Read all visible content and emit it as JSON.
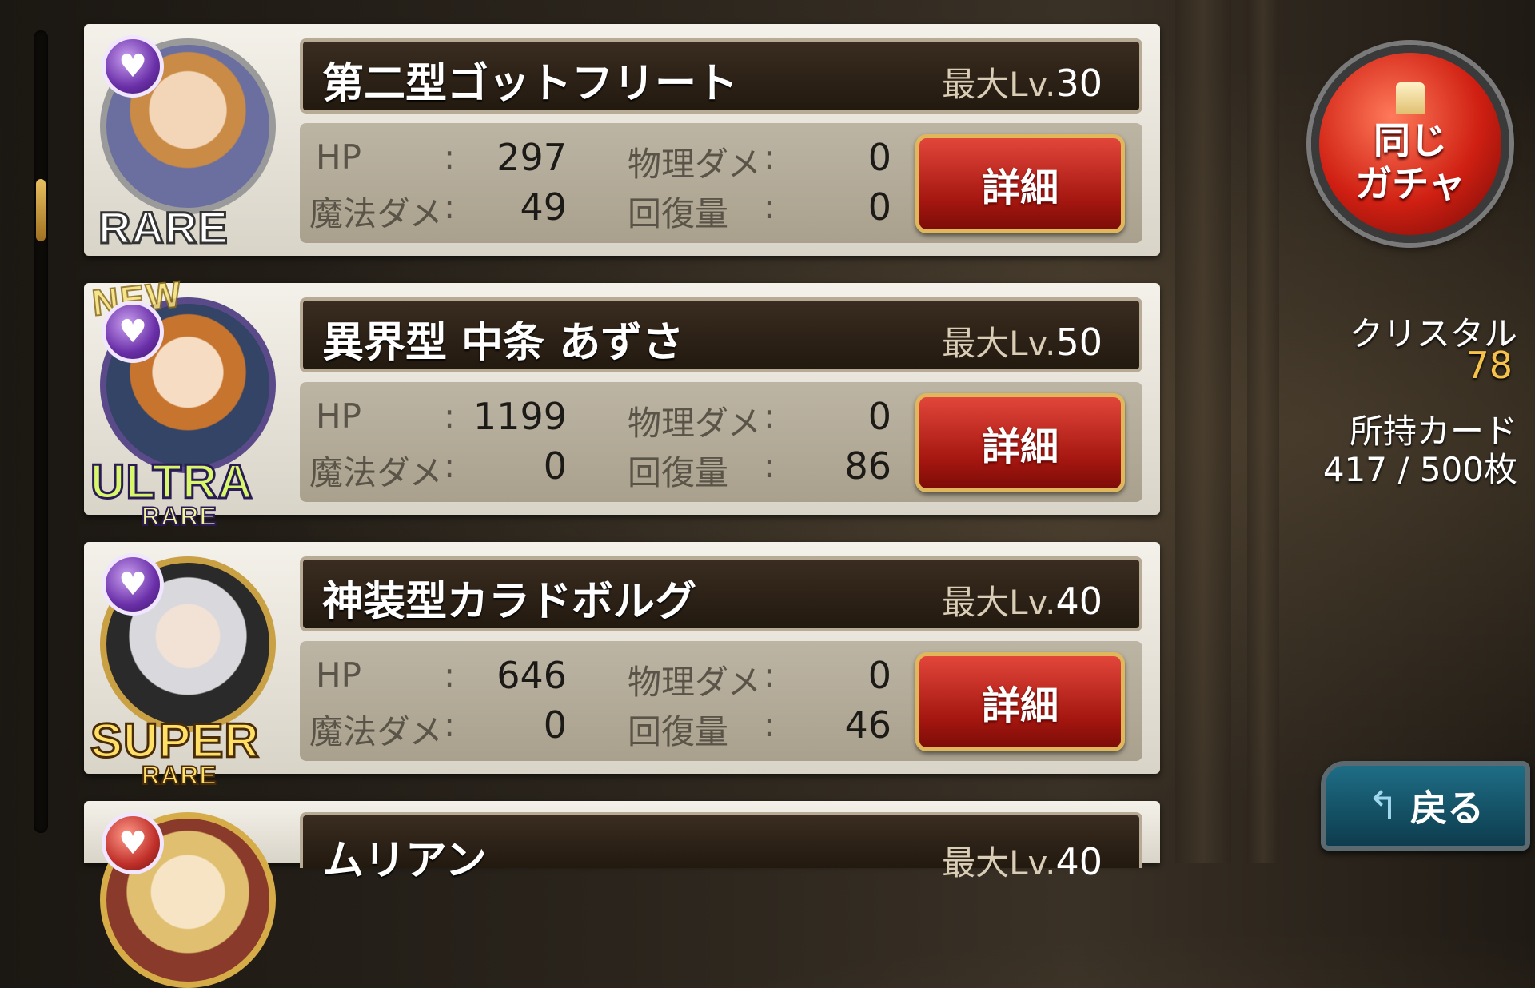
{
  "cards": [
    {
      "name": "第二型ゴットフリート",
      "lv_prefix": "最大Lv.",
      "lv": "30",
      "rarity": "RARE",
      "rarity_sub": "",
      "is_new": false,
      "stats": {
        "hp_label": "HP",
        "hp": "297",
        "phys_label": "物理ダメ",
        "phys": "0",
        "magic_label": "魔法ダメ",
        "magic": "49",
        "heal_label": "回復量",
        "heal": "0"
      },
      "detail_label": "詳細"
    },
    {
      "name": "異界型 中条 あずさ",
      "lv_prefix": "最大Lv.",
      "lv": "50",
      "rarity": "ULTRA",
      "rarity_sub": "RARE",
      "is_new": true,
      "new_label": "NEW",
      "stats": {
        "hp_label": "HP",
        "hp": "1199",
        "phys_label": "物理ダメ",
        "phys": "0",
        "magic_label": "魔法ダメ",
        "magic": "0",
        "heal_label": "回復量",
        "heal": "86"
      },
      "detail_label": "詳細"
    },
    {
      "name": "神装型カラドボルグ",
      "lv_prefix": "最大Lv.",
      "lv": "40",
      "rarity": "SUPER",
      "rarity_sub": "RARE",
      "is_new": false,
      "stats": {
        "hp_label": "HP",
        "hp": "646",
        "phys_label": "物理ダメ",
        "phys": "0",
        "magic_label": "魔法ダメ",
        "magic": "0",
        "heal_label": "回復量",
        "heal": "46"
      },
      "detail_label": "詳細"
    },
    {
      "name": "ムリアン",
      "lv_prefix": "最大Lv.",
      "lv": "40"
    }
  ],
  "colon": ":",
  "gacha_button": {
    "line1": "同じ",
    "line2": "ガチャ"
  },
  "crystal": {
    "label": "クリスタル",
    "value": "78"
  },
  "owned_cards": {
    "label": "所持カード",
    "value": "417 / 500枚"
  },
  "back_button": {
    "label": "戻る"
  },
  "icons": {
    "heart": "heart-icon",
    "back": "back-arrow-icon",
    "gacha": "capsule-icon"
  },
  "colors": {
    "detail_button": "#b51d14",
    "crystal_value": "#f6c24a",
    "back_button": "#155a70"
  }
}
